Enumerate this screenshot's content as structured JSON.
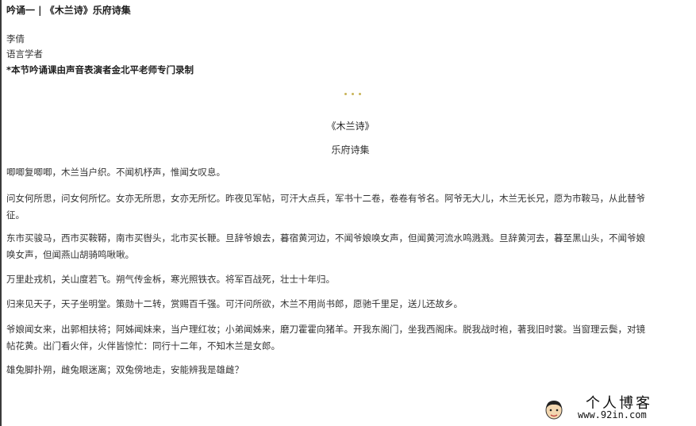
{
  "header": {
    "title": "吟诵一 | 《木兰诗》乐府诗集",
    "author_name": "李倩",
    "author_role": "语言学者",
    "note": "*本节吟诵课由声音表演者金北平老师专门录制"
  },
  "colors": {
    "divider_dots": "#c9b458"
  },
  "poem": {
    "title": "《木兰诗》",
    "source": "乐府诗集",
    "stanzas": [
      [
        "唧唧复唧唧，木兰当户织。不闻机杼声，惟闻女叹息。"
      ],
      [
        "问女何所思，问女何所忆。女亦无所思，女亦无所忆。昨夜见军帖，可汗大点兵，军书十二卷，卷卷有爷名。阿爷无大儿，木兰无长兄，愿为市鞍马，从此替爷",
        "征。"
      ],
      [
        "东市买骏马，西市买鞍鞯，南市买辔头，北市买长鞭。旦辞爷娘去，暮宿黄河边，不闻爷娘唤女声，但闻黄河流水鸣溅溅。旦辞黄河去，暮至黑山头，不闻爷娘",
        "唤女声，但闻燕山胡骑鸣啾啾。"
      ],
      [
        "万里赴戎机，关山度若飞。朔气传金柝，寒光照铁衣。将军百战死，壮士十年归。"
      ],
      [
        "归来见天子，天子坐明堂。策勋十二转，赏赐百千强。可汗问所欲，木兰不用尚书郎，愿驰千里足，送儿还故乡。"
      ],
      [
        "爷娘闻女来，出郭相扶将；阿姊闻妹来，当户理红妆；小弟闻姊来，磨刀霍霍向猪羊。开我东阁门，坐我西阁床。脱我战时袍，著我旧时裳。当窗理云鬓，对镜",
        "帖花黄。出门看火伴，火伴皆惊忙：同行十二年，不知木兰是女郎。"
      ],
      [
        "雄兔脚扑朔，雌兔眼迷离；双兔傍地走，安能辨我是雄雌？"
      ]
    ]
  },
  "watermark": {
    "name": "个人博客",
    "url": "www.92in.com",
    "icon": "cartoon-face-icon"
  }
}
